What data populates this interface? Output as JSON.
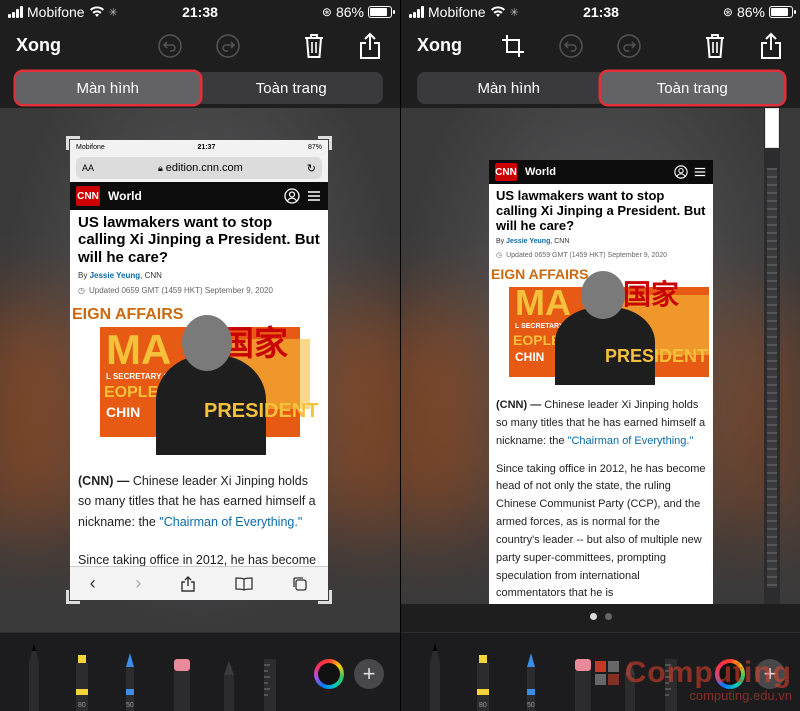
{
  "status": {
    "carrier": "Mobifone",
    "time": "21:38",
    "battery": "86%"
  },
  "toolbar": {
    "done_label": "Xong"
  },
  "segments": {
    "screen": "Màn hình",
    "full_page": "Toàn trang"
  },
  "phone_status": {
    "carrier": "Mobifone",
    "time": "21:37",
    "battery": "87%"
  },
  "browser": {
    "text_size": "AA",
    "url": "edition.cnn.com"
  },
  "article": {
    "brand": "CNN",
    "section": "World",
    "headline": "US lawmakers want to stop calling Xi Jinping a President. But will he care?",
    "byline_prefix": "By",
    "author": "Jessie Yeung",
    "source": ", CNN",
    "updated": "Updated 0659 GMT (1459 HKT) September 9, 2020",
    "image_text": {
      "top": "EIGN AFFAIRS",
      "big": "MA",
      "chinese": "国家",
      "party": "L SECRETARY OF COMMUNIST PARTY",
      "people": "EOPLE'S",
      "china": "CHIN",
      "president": "PRESIDENT"
    },
    "lead_tag": "(CNN) —",
    "lead_text": " Chinese leader Xi Jinping holds so many titles that he has earned himself a nickname: the ",
    "lead_link": "\"Chairman of Everything.\"",
    "p2": "Since taking office in 2012, he has become head of not only the state, the ruling Chinese Communist Party (CCP), and the armed forces, as is normal for the country's leader -- but also of multiple new party super-committees, prompting speculation from international commentators that he is",
    "p2_cut": "Since taking office in 2012, he has become"
  },
  "watermark": {
    "brand": "Computing",
    "url": "computing.edu.vn"
  },
  "tools": {
    "marker_width": "80",
    "pen_width": "50"
  },
  "colors": {
    "highlight": "#e0303a",
    "cnn_red": "#cc0000",
    "link": "#0c6aa8",
    "watermark": "#e8422a"
  },
  "icons": [
    "wifi-icon",
    "undo-icon",
    "redo-icon",
    "trash-icon",
    "share-icon",
    "crop-icon",
    "lock-icon",
    "reload-icon",
    "account-icon",
    "menu-icon",
    "clock-icon",
    "back-icon",
    "forward-icon",
    "bookmarks-icon",
    "tabs-icon",
    "color-wheel-icon",
    "plus-icon"
  ]
}
